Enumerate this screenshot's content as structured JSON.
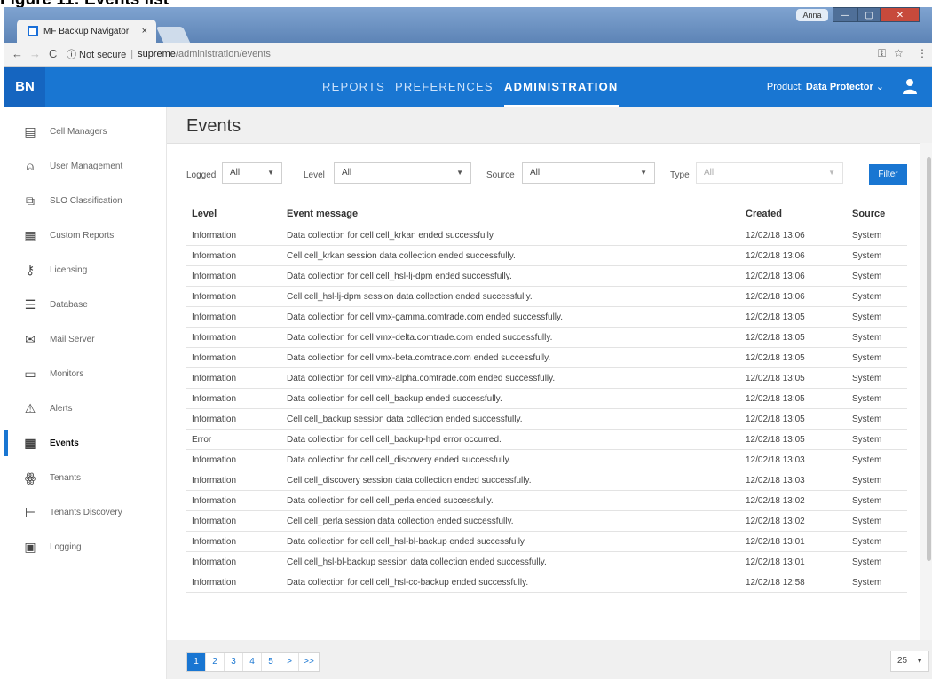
{
  "caption": "Figure 11: Events list",
  "browser": {
    "tab_title": "MF Backup Navigator",
    "tab_close": "×",
    "user_chip": "Anna",
    "address": {
      "not_secure": "ⓘ Not secure",
      "separator": "|",
      "host": "supreme",
      "path": "/administration/events"
    }
  },
  "app": {
    "logo": "BN",
    "nav": [
      "REPORTS",
      "PREFERENCES",
      "ADMINISTRATION"
    ],
    "product_label": "Product:",
    "product_value": "Data Protector",
    "product_caret": "⌄"
  },
  "sidebar": {
    "items": [
      {
        "label": "Cell Managers",
        "icon": "server-icon"
      },
      {
        "label": "User Management",
        "icon": "user-icon"
      },
      {
        "label": "SLO Classification",
        "icon": "copy-icon"
      },
      {
        "label": "Custom Reports",
        "icon": "report-icon"
      },
      {
        "label": "Licensing",
        "icon": "key-icon"
      },
      {
        "label": "Database",
        "icon": "database-icon"
      },
      {
        "label": "Mail Server",
        "icon": "mail-icon"
      },
      {
        "label": "Monitors",
        "icon": "monitor-icon"
      },
      {
        "label": "Alerts",
        "icon": "alert-icon"
      },
      {
        "label": "Events",
        "icon": "calendar-icon"
      },
      {
        "label": "Tenants",
        "icon": "tenants-icon"
      },
      {
        "label": "Tenants Discovery",
        "icon": "hierarchy-icon"
      },
      {
        "label": "Logging",
        "icon": "log-icon"
      }
    ]
  },
  "page": {
    "title": "Events",
    "filters": {
      "logged_label": "Logged",
      "logged_value": "All",
      "level_label": "Level",
      "level_value": "All",
      "source_label": "Source",
      "source_value": "All",
      "type_label": "Type",
      "type_value": "All",
      "filter_button": "Filter"
    },
    "columns": [
      "Level",
      "Event message",
      "Created",
      "Source"
    ],
    "rows": [
      [
        "Information",
        "Data collection for cell cell_krkan ended successfully.",
        "12/02/18 13:06",
        "System"
      ],
      [
        "Information",
        "Cell cell_krkan session data collection ended successfully.",
        "12/02/18 13:06",
        "System"
      ],
      [
        "Information",
        "Data collection for cell cell_hsl-lj-dpm ended successfully.",
        "12/02/18 13:06",
        "System"
      ],
      [
        "Information",
        "Cell cell_hsl-lj-dpm session data collection ended successfully.",
        "12/02/18 13:06",
        "System"
      ],
      [
        "Information",
        "Data collection for cell vmx-gamma.comtrade.com ended successfully.",
        "12/02/18 13:05",
        "System"
      ],
      [
        "Information",
        "Data collection for cell vmx-delta.comtrade.com ended successfully.",
        "12/02/18 13:05",
        "System"
      ],
      [
        "Information",
        "Data collection for cell vmx-beta.comtrade.com ended successfully.",
        "12/02/18 13:05",
        "System"
      ],
      [
        "Information",
        "Data collection for cell vmx-alpha.comtrade.com ended successfully.",
        "12/02/18 13:05",
        "System"
      ],
      [
        "Information",
        "Data collection for cell cell_backup ended successfully.",
        "12/02/18 13:05",
        "System"
      ],
      [
        "Information",
        "Cell cell_backup session data collection ended successfully.",
        "12/02/18 13:05",
        "System"
      ],
      [
        "Error",
        "Data collection for cell cell_backup-hpd error occurred.",
        "12/02/18 13:05",
        "System"
      ],
      [
        "Information",
        "Data collection for cell cell_discovery ended successfully.",
        "12/02/18 13:03",
        "System"
      ],
      [
        "Information",
        "Cell cell_discovery session data collection ended successfully.",
        "12/02/18 13:03",
        "System"
      ],
      [
        "Information",
        "Data collection for cell cell_perla ended successfully.",
        "12/02/18 13:02",
        "System"
      ],
      [
        "Information",
        "Cell cell_perla session data collection ended successfully.",
        "12/02/18 13:02",
        "System"
      ],
      [
        "Information",
        "Data collection for cell cell_hsl-bl-backup ended successfully.",
        "12/02/18 13:01",
        "System"
      ],
      [
        "Information",
        "Cell cell_hsl-bl-backup session data collection ended successfully.",
        "12/02/18 13:01",
        "System"
      ],
      [
        "Information",
        "Data collection for cell cell_hsl-cc-backup ended successfully.",
        "12/02/18 12:58",
        "System"
      ]
    ],
    "pagination": [
      "1",
      "2",
      "3",
      "4",
      "5",
      ">",
      ">>"
    ],
    "page_size": "25"
  },
  "colors": {
    "accent": "#1976d2",
    "logo_bg": "#1565c0"
  }
}
